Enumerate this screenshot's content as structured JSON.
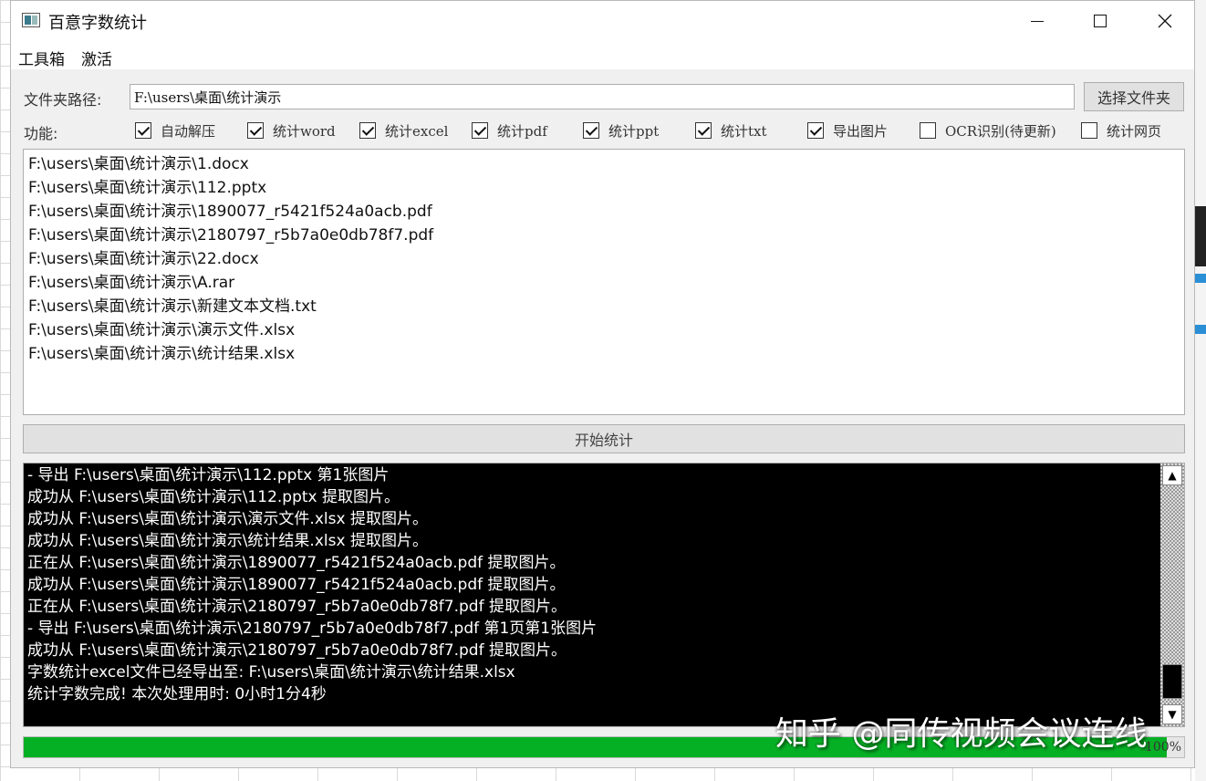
{
  "window": {
    "title": "百意字数统计"
  },
  "menubar": {
    "items": [
      "工具箱",
      "激活"
    ]
  },
  "path": {
    "label": "文件夹路径:",
    "value": "F:\\users\\桌面\\统计演示",
    "button": "选择文件夹"
  },
  "functions": {
    "label": "功能:",
    "options": [
      {
        "label": "自动解压",
        "checked": true
      },
      {
        "label": "统计word",
        "checked": true
      },
      {
        "label": "统计excel",
        "checked": true
      },
      {
        "label": "统计pdf",
        "checked": true
      },
      {
        "label": "统计ppt",
        "checked": true
      },
      {
        "label": "统计txt",
        "checked": true
      },
      {
        "label": "导出图片",
        "checked": true
      },
      {
        "label": "OCR识别(待更新)",
        "checked": false
      },
      {
        "label": "统计网页",
        "checked": false
      }
    ]
  },
  "files": [
    "F:\\users\\桌面\\统计演示\\1.docx",
    "F:\\users\\桌面\\统计演示\\112.pptx",
    "F:\\users\\桌面\\统计演示\\1890077_r5421f524a0acb.pdf",
    "F:\\users\\桌面\\统计演示\\2180797_r5b7a0e0db78f7.pdf",
    "F:\\users\\桌面\\统计演示\\22.docx",
    "F:\\users\\桌面\\统计演示\\A.rar",
    "F:\\users\\桌面\\统计演示\\新建文本文档.txt",
    "F:\\users\\桌面\\统计演示\\演示文件.xlsx",
    "F:\\users\\桌面\\统计演示\\统计结果.xlsx"
  ],
  "start_button": "开始统计",
  "log": [
    "- 导出 F:\\users\\桌面\\统计演示\\112.pptx 第1张图片",
    "成功从 F:\\users\\桌面\\统计演示\\112.pptx 提取图片。",
    "成功从 F:\\users\\桌面\\统计演示\\演示文件.xlsx 提取图片。",
    "成功从 F:\\users\\桌面\\统计演示\\统计结果.xlsx 提取图片。",
    "正在从 F:\\users\\桌面\\统计演示\\1890077_r5421f524a0acb.pdf 提取图片。",
    "成功从 F:\\users\\桌面\\统计演示\\1890077_r5421f524a0acb.pdf 提取图片。",
    "正在从 F:\\users\\桌面\\统计演示\\2180797_r5b7a0e0db78f7.pdf 提取图片。",
    "- 导出 F:\\users\\桌面\\统计演示\\2180797_r5b7a0e0db78f7.pdf 第1页第1张图片",
    "成功从 F:\\users\\桌面\\统计演示\\2180797_r5b7a0e0db78f7.pdf 提取图片。",
    "字数统计excel文件已经导出至: F:\\users\\桌面\\统计演示\\统计结果.xlsx",
    "统计字数完成! 本次处理用时: 0小时1分4秒"
  ],
  "progress": {
    "value": 100,
    "text": "100%",
    "color": "#06b025"
  },
  "watermark": "知乎 @同传视频会议连线",
  "icons": {
    "app": "app-icon",
    "minimize": "minimize-icon",
    "maximize": "maximize-icon",
    "close": "close-icon"
  }
}
